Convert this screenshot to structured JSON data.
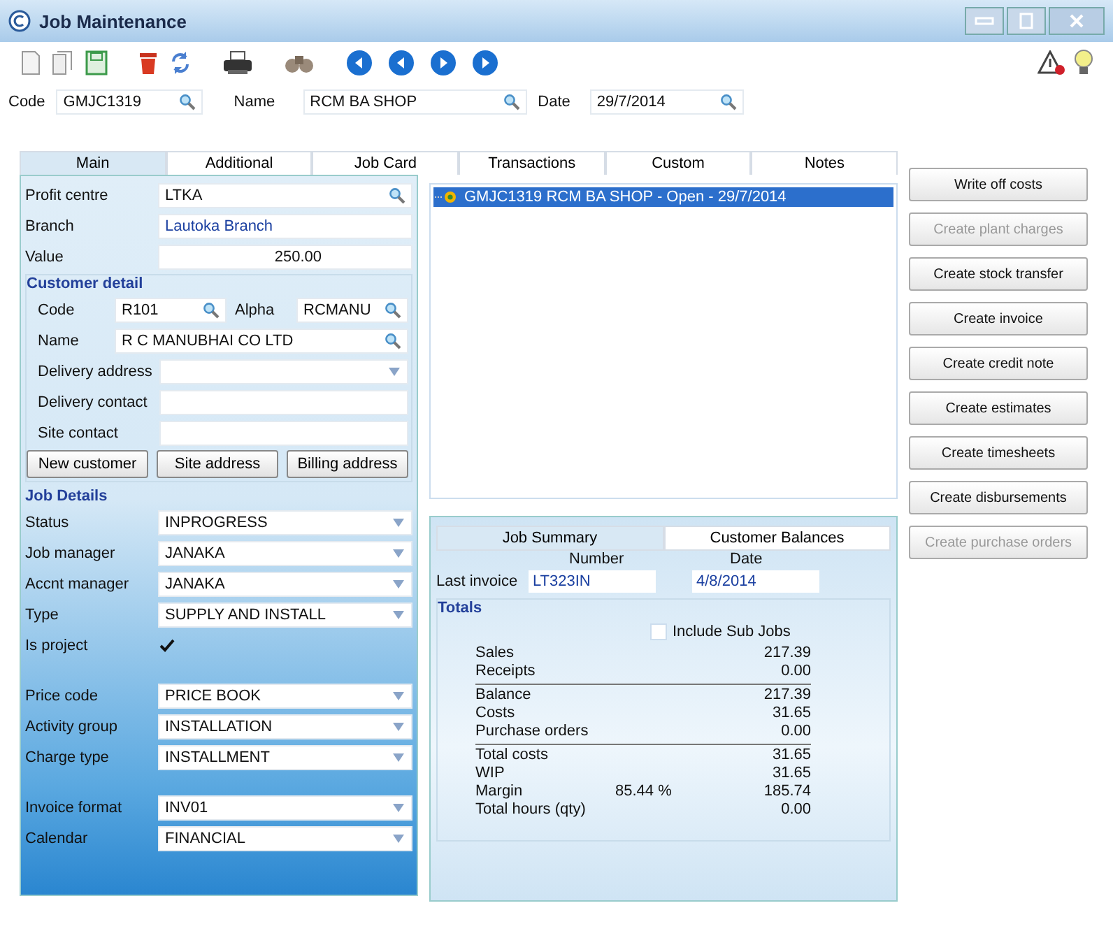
{
  "window": {
    "title": "Job Maintenance"
  },
  "header": [
    {
      "label": "Code",
      "value": "GMJC1319",
      "kind": "lookup"
    },
    {
      "label": "Name",
      "value": "RCM BA SHOP",
      "kind": "lookup"
    },
    {
      "label": "Date",
      "value": "29/7/2014",
      "kind": "lookup"
    }
  ],
  "tabs": [
    {
      "label": "Main",
      "selected": true
    },
    {
      "label": "Additional",
      "selected": false
    },
    {
      "label": "Job Card",
      "selected": false
    },
    {
      "label": "Transactions",
      "selected": false
    },
    {
      "label": "Custom",
      "selected": false
    },
    {
      "label": "Notes",
      "selected": false
    }
  ],
  "main": {
    "fields": [
      {
        "label": "Profit centre",
        "value": "LTKA",
        "kind": "lookup"
      },
      {
        "label": "Branch",
        "value": "Lautoka Branch",
        "kind": "info"
      },
      {
        "label": "Value",
        "value": "250.00",
        "kind": "number"
      }
    ],
    "customer_detail": {
      "title": "Customer detail",
      "rows": [
        [
          {
            "label": "Code",
            "value": "R101",
            "kind": "lookup"
          },
          {
            "label": "Alpha",
            "value": "RCMANU",
            "kind": "lookup"
          }
        ],
        [
          {
            "label": "Name",
            "value": "R C MANUBHAI CO LTD",
            "kind": "lookup"
          }
        ],
        [
          {
            "label": "Delivery address",
            "kind": "dropdown"
          }
        ],
        [
          {
            "label": "Delivery contact",
            "kind": "text"
          }
        ],
        [
          {
            "label": "Site contact",
            "kind": "text"
          }
        ]
      ],
      "buttons": [
        "New customer",
        "Site address",
        "Billing address"
      ]
    },
    "job_details": {
      "title": "Job Details",
      "groups": [
        [
          {
            "label": "Status",
            "value": "INPROGRESS",
            "kind": "dropdown"
          },
          {
            "label": "Job manager",
            "value": "JANAKA",
            "kind": "dropdown"
          },
          {
            "label": "Accnt manager",
            "value": "JANAKA",
            "kind": "dropdown"
          },
          {
            "label": "Type",
            "value": "SUPPLY AND INSTALL",
            "kind": "dropdown"
          },
          {
            "label": "Is project",
            "checked": true,
            "kind": "checkbox"
          }
        ],
        [
          {
            "label": "Price code",
            "value": "PRICE BOOK",
            "kind": "dropdown"
          },
          {
            "label": "Activity group",
            "value": "INSTALLATION",
            "kind": "dropdown"
          },
          {
            "label": "Charge type",
            "value": "INSTALLMENT",
            "kind": "dropdown"
          }
        ],
        [
          {
            "label": "Invoice format",
            "value": "INV01",
            "kind": "dropdown"
          },
          {
            "label": "Calendar",
            "value": "FINANCIAL",
            "kind": "dropdown"
          }
        ]
      ]
    }
  },
  "tree": {
    "items": [
      {
        "label": "GMJC1319 RCM BA SHOP - Open - 29/7/2014",
        "selected": true
      }
    ]
  },
  "actions": [
    {
      "label": "Write off costs",
      "disabled": false
    },
    {
      "label": "Create plant charges",
      "disabled": true
    },
    {
      "label": "Create stock transfer",
      "disabled": false
    },
    {
      "label": "Create invoice",
      "disabled": false
    },
    {
      "label": "Create credit note",
      "disabled": false
    },
    {
      "label": "Create estimates",
      "disabled": false
    },
    {
      "label": "Create timesheets",
      "disabled": false
    },
    {
      "label": "Create disbursements",
      "disabled": false
    },
    {
      "label": "Create purchase orders",
      "disabled": true
    }
  ],
  "summary": {
    "tabs": [
      {
        "label": "Job Summary",
        "selected": true
      },
      {
        "label": "Customer Balances",
        "selected": false
      }
    ],
    "number_label": "Number",
    "date_label": "Date",
    "last_invoice": {
      "label": "Last invoice",
      "number": "LT323IN",
      "date": "4/8/2014"
    },
    "totals": {
      "title": "Totals",
      "include_sub_jobs": {
        "label": "Include Sub Jobs",
        "checked": false
      },
      "rows": [
        {
          "label": "Sales",
          "value": "217.39",
          "rule_before": false
        },
        {
          "label": "Receipts",
          "value": "0.00",
          "rule_before": false
        },
        {
          "label": "Balance",
          "value": "217.39",
          "rule_before": true
        },
        {
          "label": "Costs",
          "value": "31.65",
          "rule_before": false
        },
        {
          "label": "Purchase orders",
          "value": "0.00",
          "rule_before": false
        },
        {
          "label": "Total costs",
          "value": "31.65",
          "rule_before": true
        },
        {
          "label": "WIP",
          "value": "31.65",
          "rule_before": false
        },
        {
          "label": "Margin",
          "extra": "85.44 %",
          "value": "185.74",
          "rule_before": false
        },
        {
          "label": "Total hours (qty)",
          "value": "0.00",
          "rule_before": false
        }
      ]
    }
  }
}
